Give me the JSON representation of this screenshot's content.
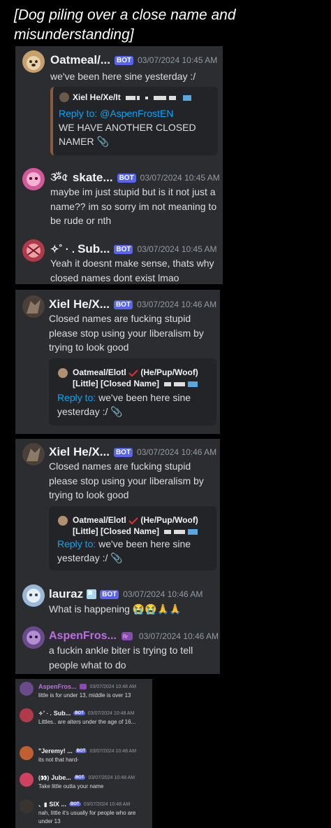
{
  "caption": "[Dog piling over a close name and misunderstanding]",
  "colors": {
    "bot_badge": "#5865f2",
    "link": "#00a8fc",
    "panel": "#2b2d31",
    "username_purple": "#c16be6"
  },
  "panel1": {
    "messages": [
      {
        "user": "Oatmeal/...",
        "badge": "BOT",
        "time": "03/07/2024 10:45 AM",
        "text": "we've been here sine yesterday :/",
        "embed": {
          "author": "Xiel He/Xe/It",
          "reply_label": "Reply to:",
          "reply_target": "@AspenFrostEN",
          "text": "WE HAVE ANOTHER CLOSED NAMER"
        }
      },
      {
        "user_prefix": "ૐ৫",
        "user": "skate...",
        "badge": "BOT",
        "time": "03/07/2024 10:45 AM",
        "text": "maybe im just stupid but is it not just a name?? im so sorry im not meaning to be rude or nth"
      },
      {
        "user_prefix": "✧˚ · .",
        "user": "Sub...",
        "badge": "BOT",
        "time": "03/07/2024 10:45 AM",
        "text": "Yeah it doesnt make sense, thats why closed names dont exist lmao"
      }
    ]
  },
  "panel2": {
    "user": "Xiel He/X...",
    "badge": "BOT",
    "time": "03/07/2024 10:46 AM",
    "text": "Closed names are fucking stupid please stop using your liberalism by trying to look good",
    "embed": {
      "author_line1": "Oatmeal/Elotl",
      "author_line1b": "(He/Pup/Woof)",
      "author_line2": "[Little] [Closed Name]",
      "reply_label": "Reply to:",
      "reply_text": "we've been here sine yesterday :/"
    }
  },
  "panel3": {
    "messages": [
      {
        "user": "Xiel He/X...",
        "badge": "BOT",
        "time": "03/07/2024 10:46 AM",
        "text": "Closed names are fucking stupid please stop using your liberalism by trying to look good",
        "embed": {
          "author_line1": "Oatmeal/Elotl",
          "author_line1b": "(He/Pup/Woof)",
          "author_line2": "[Little] [Closed Name]",
          "reply_label": "Reply to:",
          "reply_text": "we've been here sine yesterday :/"
        }
      },
      {
        "user": "lauraz",
        "badge": "BOT",
        "time": "03/07/2024 10:46 AM",
        "text": "What is happening"
      },
      {
        "user": "AspenFros...",
        "time": "03/07/2024 10:46 AM",
        "text": "a fuckin ankle biter is trying to tell people what to do"
      }
    ]
  },
  "panel4": {
    "messages": [
      {
        "user": "AspenFros...",
        "time": "03/07/2024 10:48 AM",
        "text": "little is for under 13, middle is over 13"
      },
      {
        "user_prefix": "✧˚ · .",
        "user": "Sub...",
        "badge": "BOT",
        "time": "03/07/2024 10:48 AM",
        "text": "Littles.. are alters under the age of 16..."
      },
      {
        "user": "\"Jeremy! ...",
        "badge": "BOT",
        "time": "03/07/2024 10:48 AM",
        "text": "its not that hard-"
      },
      {
        "user": "Jube...",
        "badge": "BOT",
        "time": "03/07/2024 10:48 AM",
        "text": "Take little outta your name"
      },
      {
        "user": "SIX ...",
        "badge": "BOT",
        "time": "03/07/2024 10:48 AM",
        "text": "nah, little it's usually for people who are under 13"
      }
    ]
  }
}
